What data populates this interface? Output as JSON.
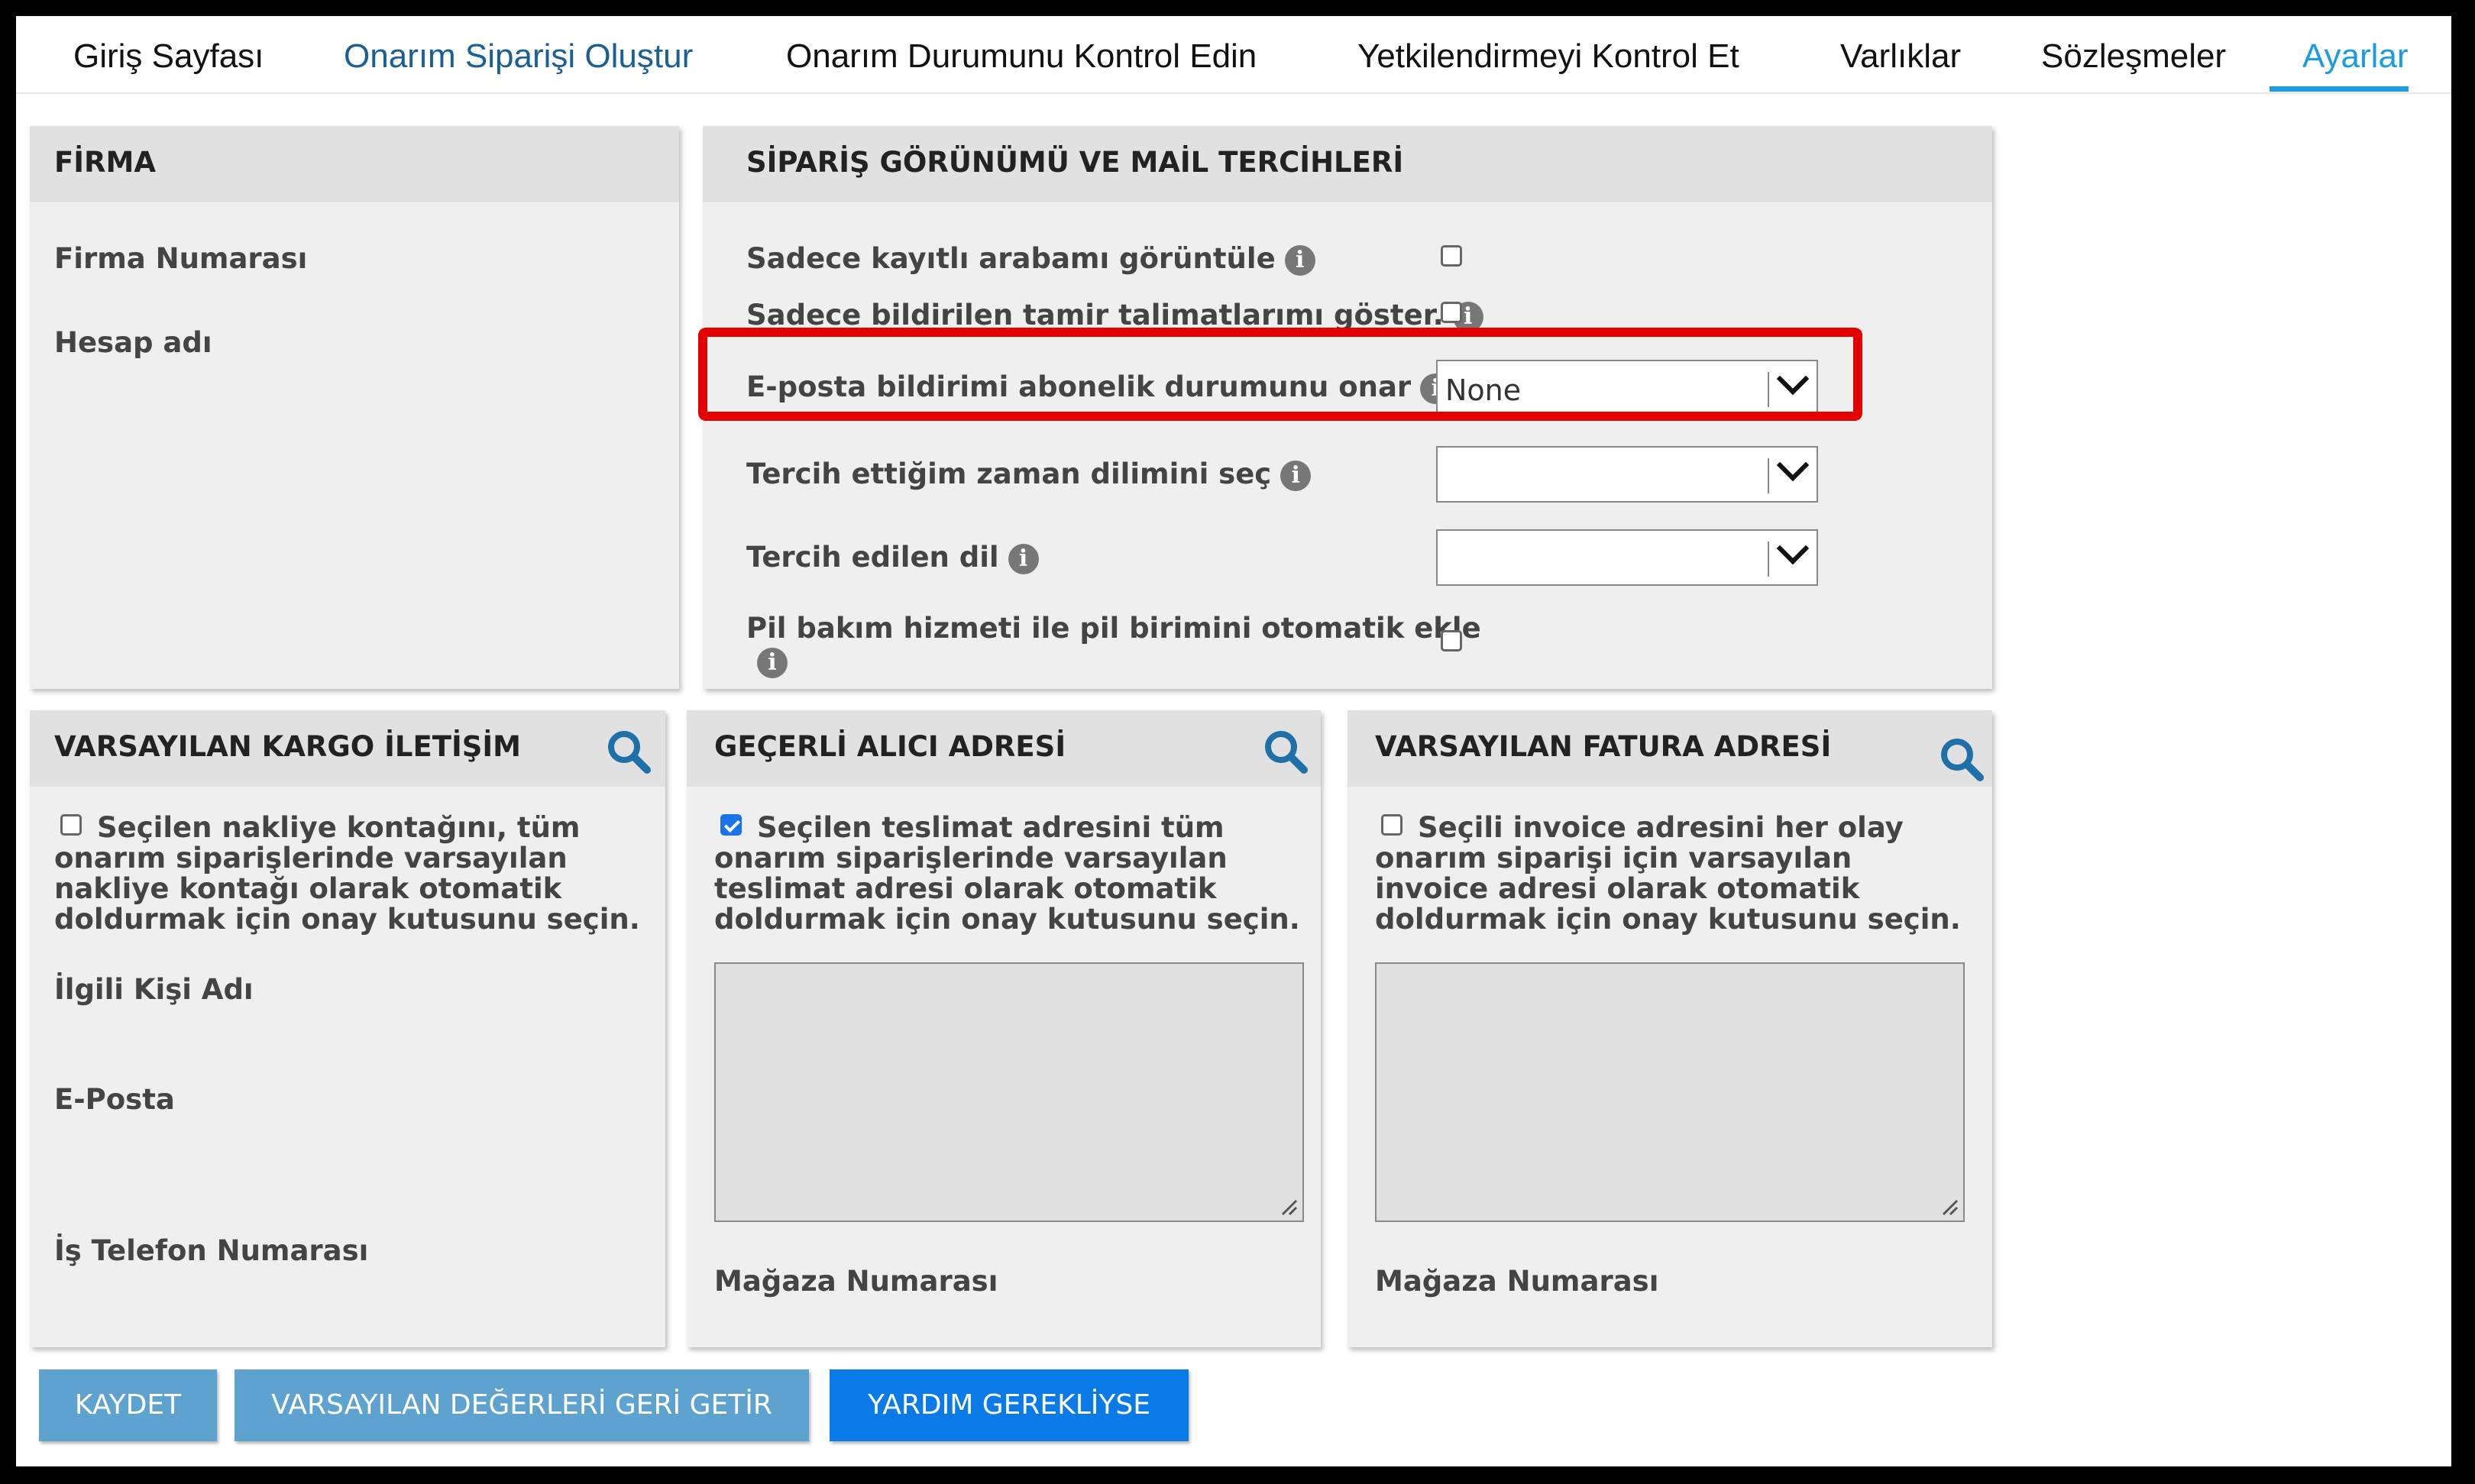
{
  "nav": {
    "tabs": [
      {
        "label": "Giriş Sayfası"
      },
      {
        "label": "Onarım Siparişi Oluştur"
      },
      {
        "label": "Onarım Durumunu Kontrol Edin"
      },
      {
        "label": "Yetkilendirmeyi Kontrol Et"
      },
      {
        "label": "Varlıklar"
      },
      {
        "label": "Sözleşmeler"
      },
      {
        "label": "Ayarlar"
      }
    ]
  },
  "firma": {
    "title": "FİRMA",
    "firma_numarasi_label": "Firma Numarası",
    "hesap_adi_label": "Hesap adı"
  },
  "prefs": {
    "title": "SİPARİŞ GÖRÜNÜMÜ VE MAİL TERCİHLERİ",
    "only_registered_label": "Sadece kayıtlı arabamı görüntüle",
    "only_registered_checked": false,
    "only_reported_label": "Sadece bildirilen tamir talimatlarımı göster.",
    "only_reported_checked": false,
    "email_sub_label": "E-posta bildirimi abonelik durumunu onar",
    "email_sub_value": "None",
    "timezone_label": "Tercih ettiğim zaman dilimini seç",
    "timezone_value": "",
    "language_label": "Tercih edilen dil",
    "language_value": "",
    "battery_label": "Pil bakım hizmeti ile pil birimini otomatik ekle",
    "battery_checked": false
  },
  "kargo": {
    "title": "VARSAYILAN KARGO İLETİŞİM",
    "desc": "Seçilen nakliye kontağını, tüm onarım siparişlerinde varsayılan nakliye kontağı olarak otomatik doldurmak için onay kutusunu seçin.",
    "checked": false,
    "contact_name_label": "İlgili Kişi Adı",
    "email_label": "E-Posta",
    "phone_label": "İş Telefon Numarası"
  },
  "alici": {
    "title": "GEÇERLİ ALICI ADRESİ",
    "desc": "Seçilen teslimat adresini tüm onarım siparişlerinde varsayılan teslimat adresi olarak otomatik doldurmak için onay kutusunu seçin.",
    "checked": true,
    "store_label": "Mağaza Numarası"
  },
  "fatura": {
    "title": "VARSAYILAN FATURA ADRESİ",
    "desc": "Seçili invoice adresini her olay onarım siparişi için varsayılan invoice adresi olarak otomatik doldurmak için onay kutusunu seçin.",
    "checked": false,
    "store_label": "Mağaza Numarası"
  },
  "buttons": {
    "save": "KAYDET",
    "restore": "VARSAYILAN DEĞERLERİ GERİ GETİR",
    "help": "YARDIM GEREKLİYSE"
  },
  "colors": {
    "accent": "#1b9be0",
    "highlight": "#e50000",
    "primary_button": "#0a7ae6",
    "light_button": "#5ea3cf"
  }
}
